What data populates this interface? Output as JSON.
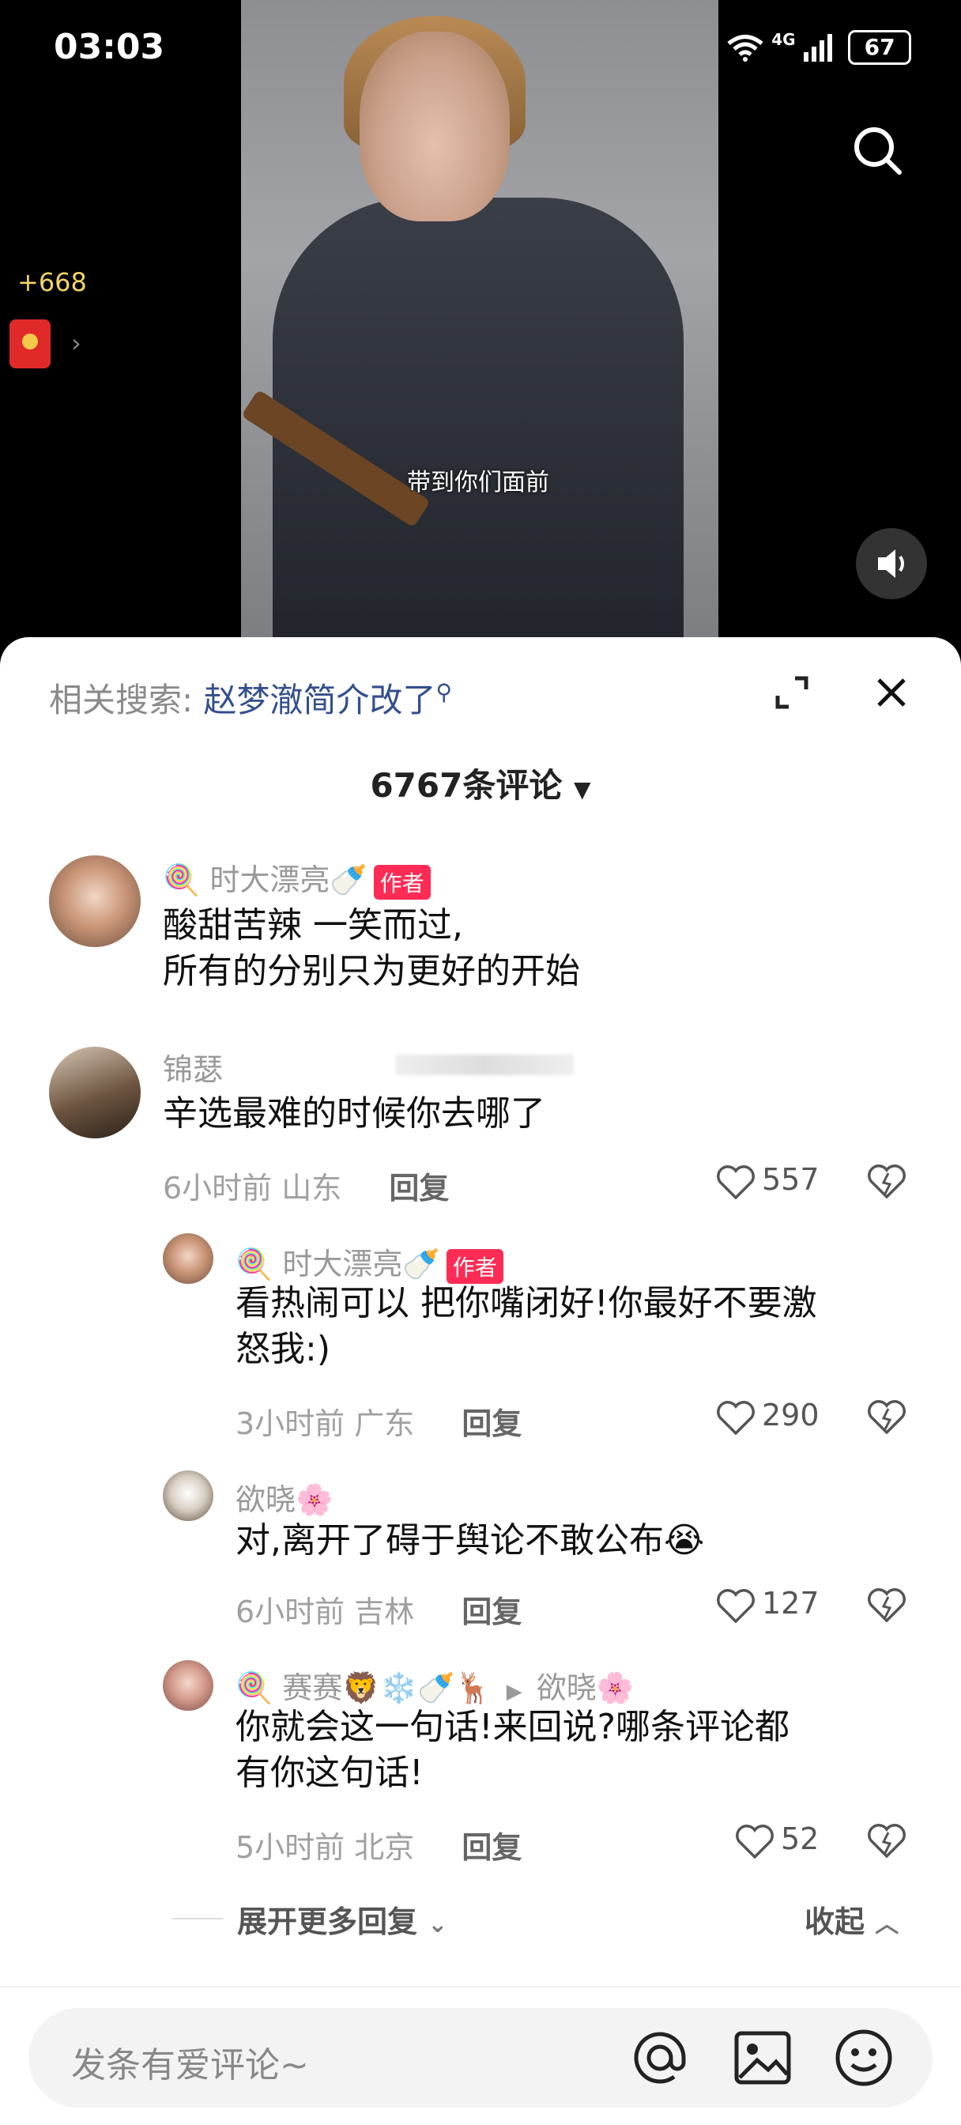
{
  "status_bar": {
    "time": "03:03",
    "network": "4G",
    "battery": "67"
  },
  "video": {
    "subtitle": "带到你们面前"
  },
  "bonus": {
    "points": "+668"
  },
  "sheet": {
    "related_label": "相关搜索:",
    "related_query": "赵梦澈简介改了",
    "comment_count": "6767条评论"
  },
  "comments": [
    {
      "name": "🍭 时大漂亮🍼",
      "badge": "作者",
      "line1": "酸甜苦辣 一笑而过,",
      "line2": "所有的分别只为更好的开始"
    },
    {
      "name": "锦瑟",
      "text": "辛选最难的时候你去哪了",
      "time": "6小时前",
      "loc": "山东",
      "reply": "回复",
      "likes": "557"
    }
  ],
  "replies": [
    {
      "name": "🍭 时大漂亮🍼",
      "badge": "作者",
      "line1": "看热闹可以 把你嘴闭好!你最好不要激",
      "line2": "怒我:)",
      "time": "3小时前",
      "loc": "广东",
      "reply": "回复",
      "likes": "290"
    },
    {
      "name": "欲晓🌸",
      "line1": "对,离开了碍于舆论不敢公布😭",
      "time": "6小时前",
      "loc": "吉林",
      "reply": "回复",
      "likes": "127"
    },
    {
      "name": "🍭 赛赛🦁❄️🍼🦌",
      "reply_to": "欲晓🌸",
      "line1": "你就会这一句话!来回说?哪条评论都",
      "line2": "有你这句话!",
      "time": "5小时前",
      "loc": "北京",
      "reply": "回复",
      "likes": "52"
    }
  ],
  "footer": {
    "expand_more": "展开更多回复",
    "collapse": "收起",
    "input_placeholder": "发条有爱评论~"
  },
  "colors": {
    "accent": "#fe2c55",
    "link": "#344f8e"
  },
  "icons": [
    "search-icon",
    "volume-icon",
    "expand-icon",
    "close-icon",
    "heart-icon",
    "dislike-icon",
    "at-icon",
    "image-icon",
    "emoji-icon"
  ]
}
